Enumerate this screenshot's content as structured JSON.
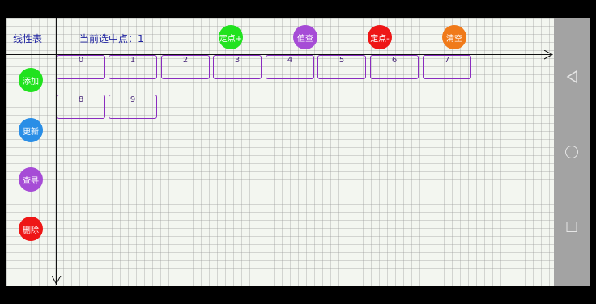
{
  "app": {
    "title": "线性表",
    "selected_label": "当前选中点：1"
  },
  "top_buttons": [
    {
      "label": "定点+",
      "color": "#21e21f",
      "icon": "insert-after"
    },
    {
      "label": "值查",
      "color": "#a64cd6",
      "icon": "search-by-value"
    },
    {
      "label": "定点-",
      "color": "#ee1616",
      "icon": "delete-at"
    },
    {
      "label": "清空",
      "color": "#f07a1a",
      "icon": "clear"
    }
  ],
  "side_buttons": [
    {
      "label": "添加",
      "color": "#21e21f"
    },
    {
      "label": "更新",
      "color": "#2a8ee6"
    },
    {
      "label": "查寻",
      "color": "#a64cd6"
    },
    {
      "label": "删除",
      "color": "#ee1616"
    }
  ],
  "nodes": [
    "0",
    "1",
    "2",
    "3",
    "4",
    "5",
    "6",
    "7",
    "8",
    "9"
  ],
  "navbar": {
    "icons": [
      "back-icon",
      "home-icon",
      "recent-apps-icon"
    ]
  }
}
